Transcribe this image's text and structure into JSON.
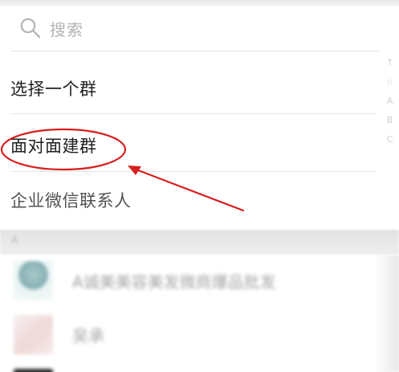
{
  "search": {
    "placeholder": "搜索",
    "icon": "search-icon"
  },
  "menu": {
    "items": [
      {
        "label": "选择一个群"
      },
      {
        "label": "面对面建群"
      },
      {
        "label": "企业微信联系人"
      }
    ]
  },
  "index": {
    "letters": [
      "↑",
      "☆",
      "A",
      "B",
      "C"
    ]
  },
  "section": {
    "letter": "A"
  },
  "contacts": [
    {
      "name": "A诚美美容美发微商爆品批发",
      "avatar": "teal-figure"
    },
    {
      "name": "吴承",
      "avatar": "pink-figure"
    },
    {
      "name": "",
      "avatar": "dark-figure"
    }
  ],
  "annotation": {
    "color": "#d71f1f"
  }
}
